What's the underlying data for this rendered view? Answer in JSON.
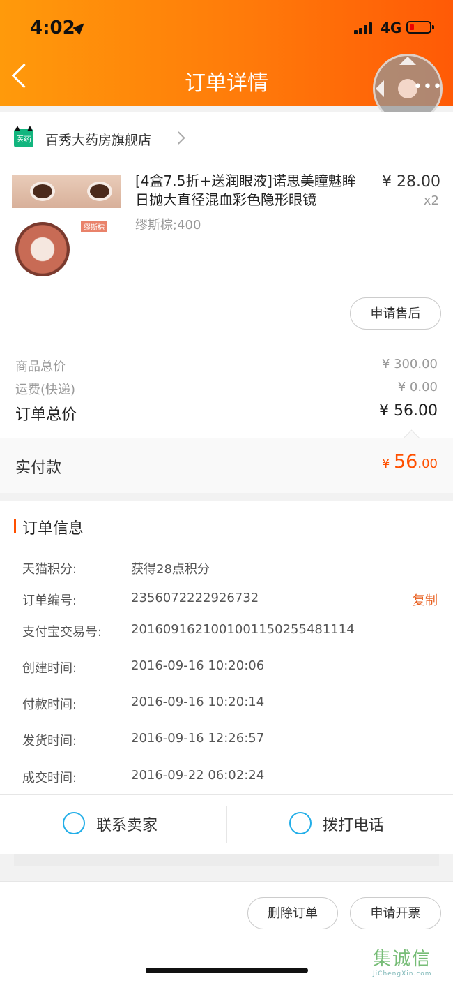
{
  "status_bar": {
    "time": "4:02",
    "network": "4G"
  },
  "header": {
    "title": "订单详情"
  },
  "shop": {
    "icon_text": "医药",
    "name": "百秀大药房旗舰店"
  },
  "product": {
    "title": "[4盒7.5折+送润眼液]诺思美瞳魅眸日抛大直径混血彩色隐形眼镜",
    "sku": "缪斯棕;400",
    "price": "¥ 28.00",
    "quantity": "x2",
    "image_tag": "缪斯棕"
  },
  "after_sale_button": "申请售后",
  "summary": {
    "goods_total_label": "商品总价",
    "goods_total_value": "¥ 300.00",
    "shipping_label": "运费(快递)",
    "shipping_value": "¥ 0.00",
    "order_total_label": "订单总价",
    "order_total_value": "¥ 56.00",
    "paid_label": "实付款",
    "paid_symbol": "¥ ",
    "paid_integer": "56",
    "paid_decimal": ".00"
  },
  "order_info": {
    "title": "订单信息",
    "rows": [
      {
        "label": "天猫积分:",
        "value": "获得28点积分"
      },
      {
        "label": "订单编号:",
        "value": "2356072222926732"
      },
      {
        "label": "支付宝交易号:",
        "value": "2016091621001001150255481114"
      },
      {
        "label": "创建时间:",
        "value": "2016-09-16 10:20:06"
      },
      {
        "label": "付款时间:",
        "value": "2016-09-16 10:20:14"
      },
      {
        "label": "发货时间:",
        "value": "2016-09-16 12:26:57"
      },
      {
        "label": "成交时间:",
        "value": "2016-09-22 06:02:24"
      }
    ],
    "copy_label": "复制"
  },
  "contact": {
    "seller_label": "联系卖家",
    "phone_label": "拨打电话"
  },
  "bottom_bar": {
    "delete_label": "删除订单",
    "invoice_label": "申请开票"
  },
  "watermark": {
    "text": "集诚信",
    "sub": "JiChengXin.com"
  },
  "colors": {
    "header_start": "#ff9a0b",
    "header_end": "#ff5a06",
    "accent": "#ff5000",
    "link_blue": "#22aee8"
  }
}
